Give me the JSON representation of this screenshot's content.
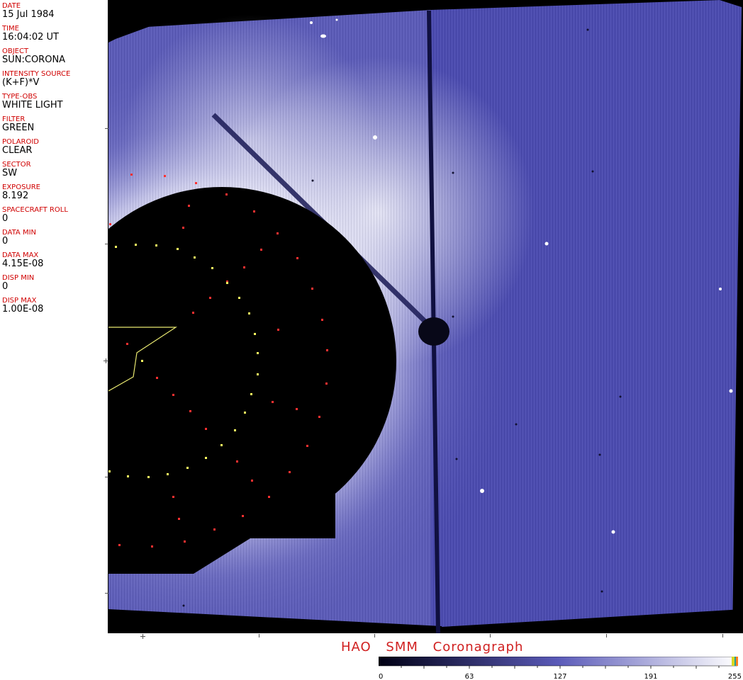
{
  "header_fields": [
    {
      "label": "DATE",
      "value": "15 Jul 1984"
    },
    {
      "label": "TIME",
      "value": "16:04:02 UT"
    },
    {
      "label": "OBJECT",
      "value": "SUN:CORONA"
    },
    {
      "label": "INTENSITY SOURCE",
      "value": "(K+F)*V"
    },
    {
      "label": "TYPE-OBS",
      "value": "WHITE LIGHT"
    },
    {
      "label": "FILTER",
      "value": "GREEN"
    },
    {
      "label": "POLAROID",
      "value": "CLEAR"
    },
    {
      "label": "SECTOR",
      "value": "SW"
    },
    {
      "label": "EXPOSURE",
      "value": "8.192"
    },
    {
      "label": "SPACECRAFT ROLL",
      "value": "0"
    },
    {
      "label": "DATA MIN",
      "value": "0"
    },
    {
      "label": "DATA MAX",
      "value": "4.15E-08"
    },
    {
      "label": "DISP MIN",
      "value": "0"
    },
    {
      "label": "DISP MAX",
      "value": "1.00E-08"
    }
  ],
  "footer": {
    "title": "HAO SMM Coronagraph"
  },
  "colorbar": {
    "ticks": [
      "0",
      "63",
      "127",
      "191",
      "255"
    ],
    "colors": {
      "dark": "#000014",
      "mid": "#5a5ab8",
      "light": "#ffffff"
    }
  }
}
